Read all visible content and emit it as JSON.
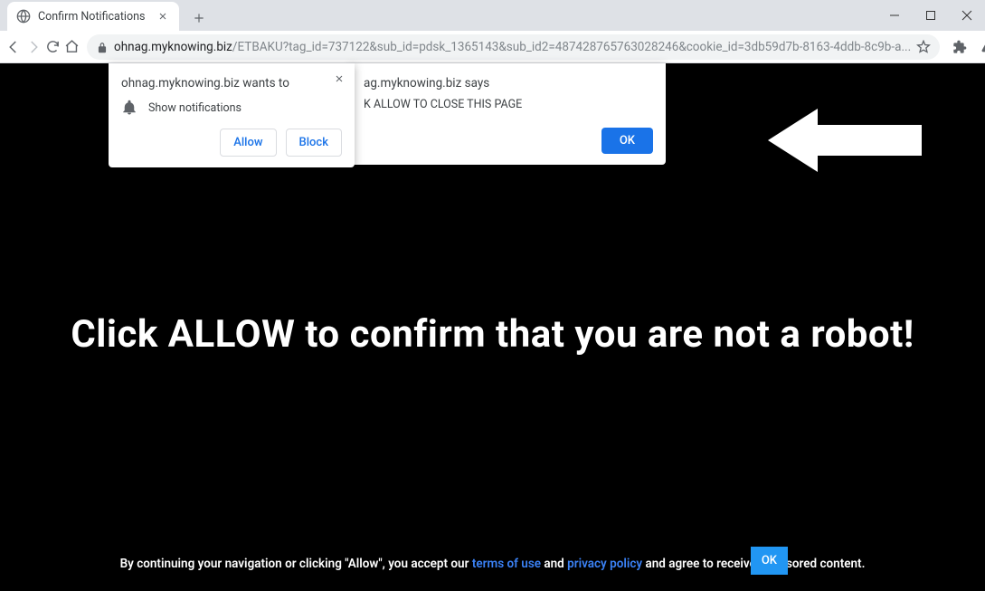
{
  "tab": {
    "title": "Confirm Notifications"
  },
  "url": {
    "domain": "ohnag.myknowing.biz",
    "path": "/ETBAKU?tag_id=737122&sub_id=pdsk_1365143&sub_id2=487428765763028246&cookie_id=3db59d7b-8163-4ddb-8c9b-a..."
  },
  "notif": {
    "head": "ohnag.myknowing.biz wants to",
    "line": "Show notifications",
    "allow": "Allow",
    "block": "Block"
  },
  "alert": {
    "head": "ag.myknowing.biz says",
    "body": "K ALLOW TO CLOSE THIS PAGE",
    "ok": "OK"
  },
  "page": {
    "main": "Click ALLOW to confirm that you are not a robot!",
    "footer_pre": "By continuing your navigation or clicking \"Allow\", you accept our ",
    "terms": "terms of use",
    "and": " and ",
    "privacy": "privacy policy",
    "footer_post": " and agree to receive sponsored content.",
    "ok": "OK"
  }
}
